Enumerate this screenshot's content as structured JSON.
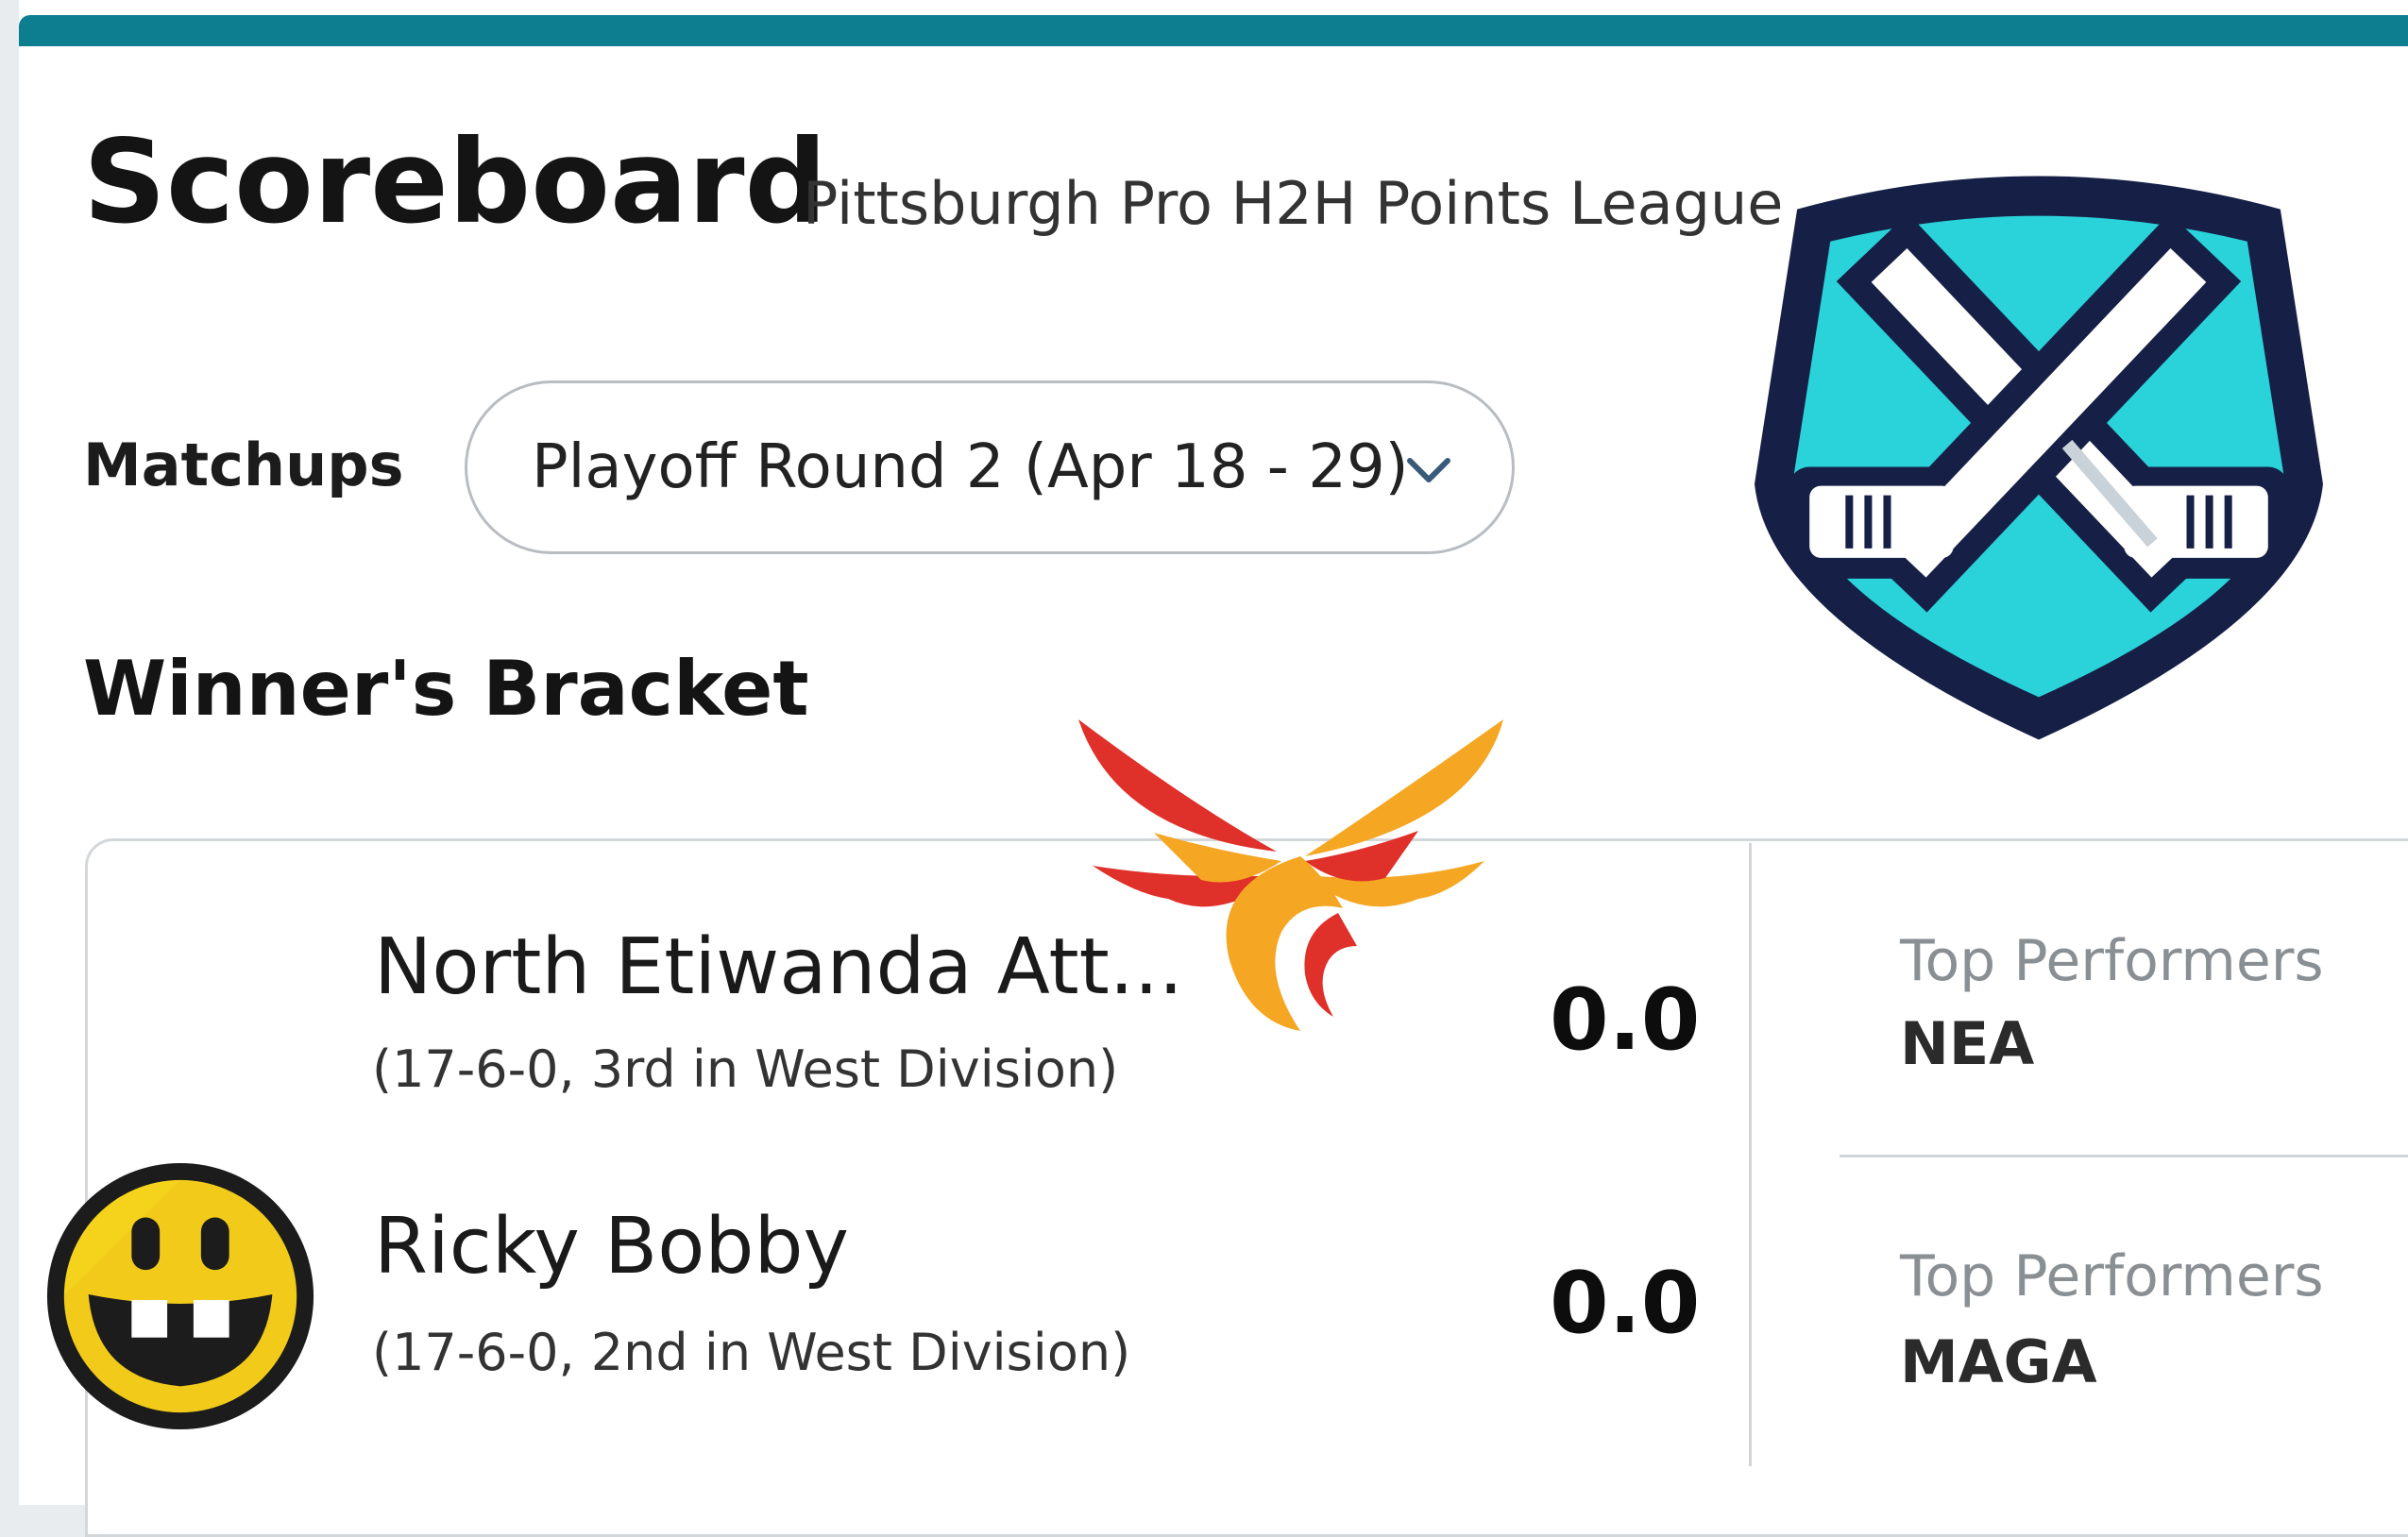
{
  "header": {
    "title": "Scoreboard",
    "league_name": "Pittsburgh Pro H2H Points League"
  },
  "matchups": {
    "label": "Matchups",
    "selected_period": "Playoff Round 2 (Apr 18 - 29)"
  },
  "bracket": {
    "title": "Winner's Bracket"
  },
  "matchup": {
    "teams": [
      {
        "name": "North Etiwanda Att...",
        "record": "(17-6-0, 3rd in West Division)",
        "score": "0.0",
        "top_performers_label": "Top Performers",
        "top_performers_value": "NEA",
        "logo": "phoenix-wings-logo"
      },
      {
        "name": "Ricky Bobby",
        "record": "(17-6-0, 2nd in West Division)",
        "score": "0.0",
        "top_performers_label": "Top Performers",
        "top_performers_value": "MAGA",
        "logo": "grinning-face-logo"
      }
    ]
  },
  "league_logo": "crossed-hockey-sticks-shield-logo",
  "colors": {
    "accent_bar": "#0d7d90",
    "shield_fill": "#2ad2da",
    "shield_outline": "#162046",
    "wing_red": "#e0302a",
    "wing_orange": "#f5a623",
    "smiley_yellow": "#f5d21c"
  }
}
